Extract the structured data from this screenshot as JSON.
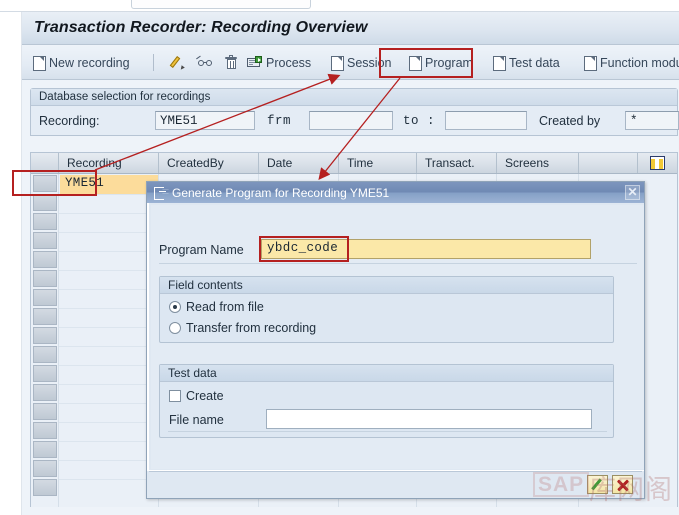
{
  "app": {
    "title": "Transaction Recorder: Recording Overview"
  },
  "toolbar": {
    "items": [
      {
        "label": "New recording",
        "icon": "document-icon"
      },
      {
        "label": "",
        "icon": "pencil-icon"
      },
      {
        "label": "",
        "icon": "glasses-display-icon"
      },
      {
        "label": "",
        "icon": "trash-delete-icon"
      },
      {
        "label": "Process",
        "icon": "process-icon"
      },
      {
        "label": "Session",
        "icon": "document-icon"
      },
      {
        "label": "Program",
        "icon": "document-icon"
      },
      {
        "label": "Test data",
        "icon": "document-icon"
      },
      {
        "label": "Function module",
        "icon": "document-icon"
      }
    ]
  },
  "db_selection": {
    "group_title": "Database selection for recordings",
    "recording_label": "Recording:",
    "recording_value": "YME51",
    "frm_label": "frm",
    "frm_value": "",
    "to_label": "to :",
    "to_value": "",
    "created_by_label": "Created by",
    "created_by_value": "*"
  },
  "table": {
    "columns": [
      "Recording",
      "CreatedBy",
      "Date",
      "Time",
      "Transact.",
      "Screens"
    ],
    "config_icon": "column-config-icon",
    "rows": [
      {
        "recording": "YME51",
        "createdby": "",
        "date": "",
        "time": "",
        "transact": "",
        "screens": ""
      }
    ]
  },
  "dialog": {
    "title": "Generate Program for Recording YME51",
    "title_icon": "generate-program-icon",
    "close_label": "✕",
    "program_name_label": "Program Name",
    "program_name_value": "ybdc_code",
    "field_contents": {
      "title": "Field contents",
      "options": [
        {
          "label": "Read from file",
          "selected": true
        },
        {
          "label": "Transfer from recording",
          "selected": false
        }
      ]
    },
    "test_data": {
      "title": "Test data",
      "create_label": "Create",
      "create_checked": false,
      "file_name_label": "File name",
      "file_name_value": ""
    },
    "footer": {
      "confirm_icon": "green-pencil-confirm-icon",
      "cancel_icon": "red-x-cancel-icon"
    }
  },
  "watermark": {
    "sap": "SAP",
    "cjk": "库网阁"
  },
  "colors": {
    "annotation_red": "#b52020",
    "highlight_yellow": "#fcdc9b",
    "input_yellow": "#fbe8a8",
    "dialog_title_blue": "#7d95bd",
    "header_blue": "#dde6f0"
  }
}
